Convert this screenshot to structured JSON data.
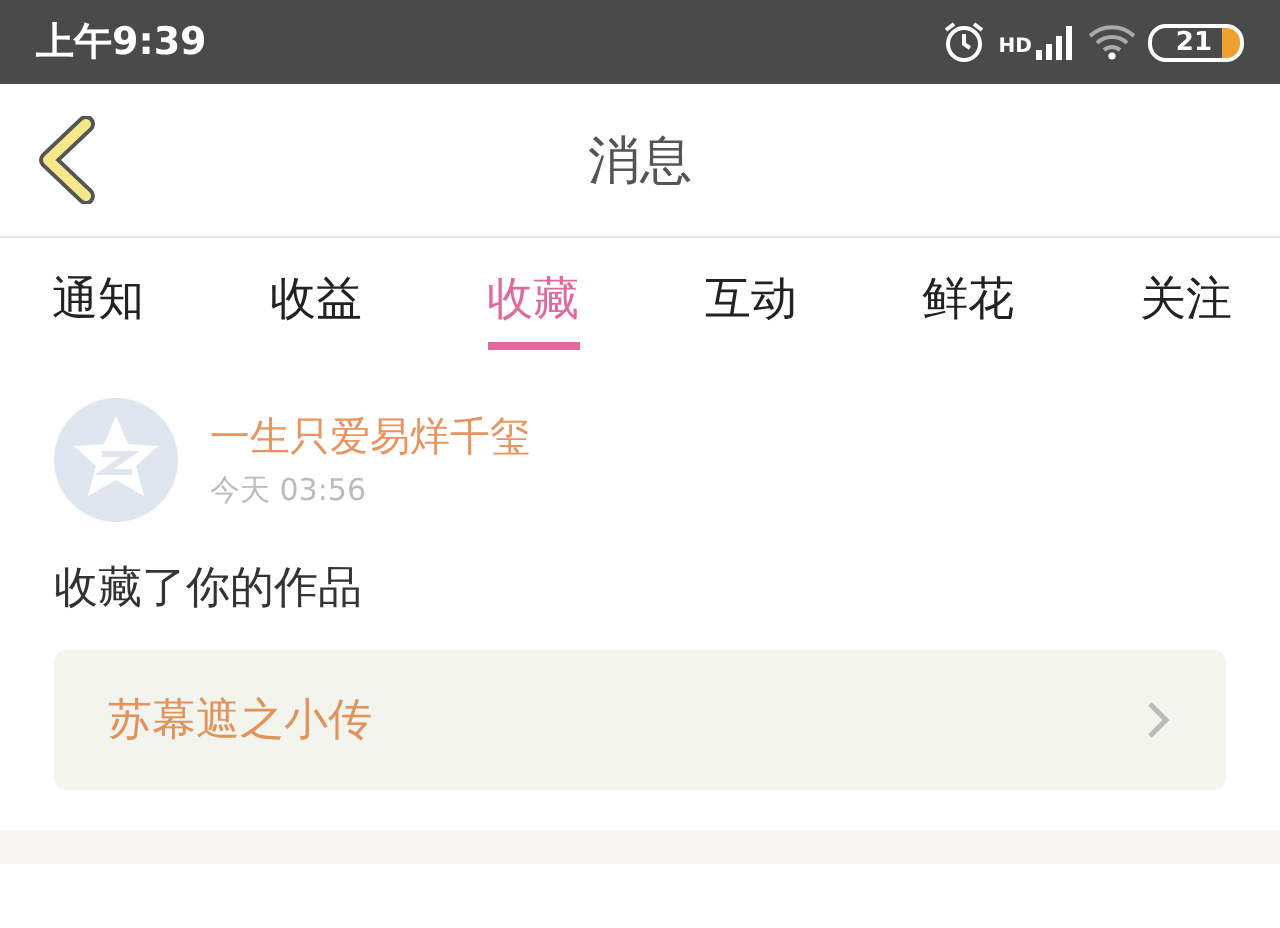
{
  "status_bar": {
    "time": "上午9:39",
    "battery": "21",
    "network_label": "HD"
  },
  "header": {
    "title": "消息"
  },
  "tabs": [
    {
      "label": "通知",
      "selected": false
    },
    {
      "label": "收益",
      "selected": false
    },
    {
      "label": "收藏",
      "selected": true
    },
    {
      "label": "互动",
      "selected": false
    },
    {
      "label": "鲜花",
      "selected": false
    },
    {
      "label": "关注",
      "selected": false
    }
  ],
  "messages": [
    {
      "user": "一生只爱易烊千玺",
      "time": "今天 03:56",
      "text": "收藏了你的作品",
      "work": "苏幕遮之小传"
    }
  ]
}
